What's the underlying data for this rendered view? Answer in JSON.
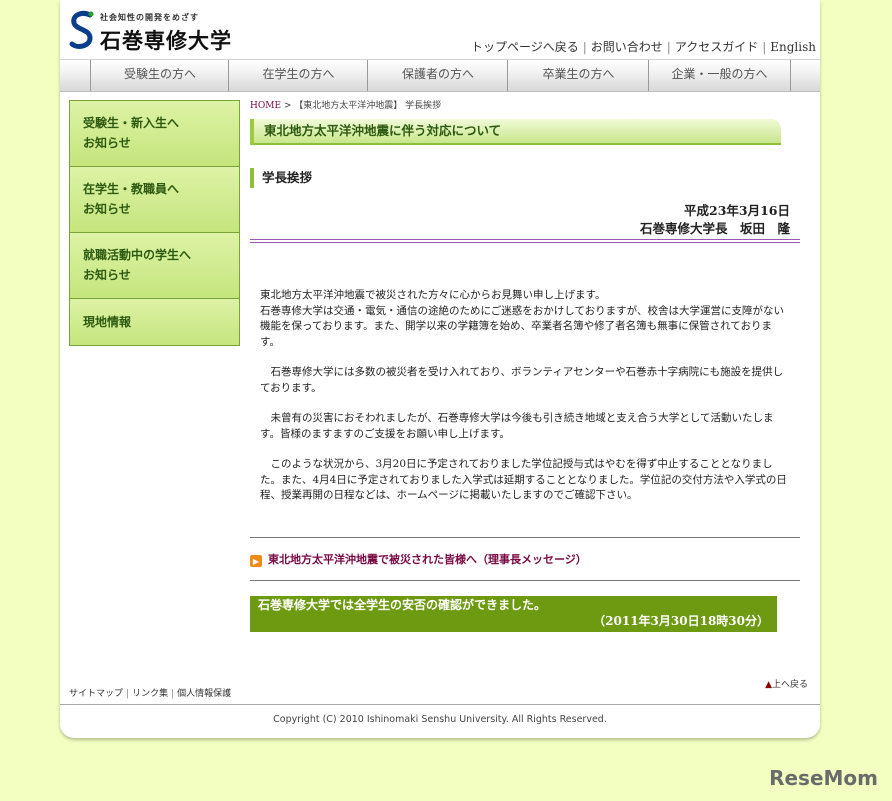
{
  "header": {
    "tagline": "社会知性の開発をめざす",
    "university_name": "石巻専修大学",
    "top_links": [
      "トップページへ戻る",
      "お問い合わせ",
      "アクセスガイド",
      "English"
    ]
  },
  "global_nav": [
    "受験生の方へ",
    "在学生の方へ",
    "保護者の方へ",
    "卒業生の方へ",
    "企業・一般の方へ"
  ],
  "sidebar": [
    {
      "line1": "受験生・新入生へ",
      "line2": "お知らせ"
    },
    {
      "line1": "在学生・教職員へ",
      "line2": "お知らせ"
    },
    {
      "line1": "就職活動中の学生へ",
      "line2": "お知らせ"
    },
    {
      "line1": "現地情報",
      "line2": ""
    }
  ],
  "breadcrumb": {
    "home": "HOME",
    "sep": " > ",
    "rest": "【東北地方太平洋沖地震】 学長挨拶"
  },
  "page_title": "東北地方太平洋沖地震に伴う対応について",
  "section_title": "学長挨拶",
  "date": "平成23年3月16日",
  "signature": "石巻専修大学長　坂田　隆",
  "paragraphs": [
    "東北地方太平洋沖地震で被災された方々に心からお見舞い申し上げます。\n石巻専修大学は交通・電気・通信の途絶のためにご迷惑をおかけしておりますが、校舎は大学運営に支障がない機能を保っております。また、開学以来の学籍簿を始め、卒業者名簿や修了者名簿も無事に保管されております。",
    "　石巻専修大学には多数の被災者を受け入れており、ボランティアセンターや石巻赤十字病院にも施設を提供しております。",
    "　未曾有の災害におそわれましたが、石巻専修大学は今後も引き続き地域と支え合う大学として活動いたします。皆様のますますのご支援をお願い申し上げます。",
    "　このような状況から、3月20日に予定されておりました学位記授与式はやむを得ず中止することとなりました。また、4月4日に予定されておりました入学式は延期することとなりました。学位記の交付方法や入学式の日程、授業再開の日程などは、ホームページに掲載いたしますのでご確認下さい。"
  ],
  "message_link": "東北地方太平洋沖地震で被災された皆様へ（理事長メッセージ）",
  "notice": {
    "line1": "石巻専修大学では全学生の安否の確認ができました。",
    "line2": "（2011年3月30日18時30分）"
  },
  "footer": {
    "links": [
      "サイトマップ",
      "リンク集",
      "個人情報保護"
    ],
    "page_top": "上へ戻る",
    "copyright": "Copyright (C) 2010 Ishinomaki Senshu University. All Rights Reserved."
  },
  "watermark": "ReseMom",
  "colors": {
    "background": "#f2ffc0",
    "accent_green": "#6d9a10",
    "link_maroon": "#7a0a44",
    "sidebar_text": "#2d5a10"
  }
}
